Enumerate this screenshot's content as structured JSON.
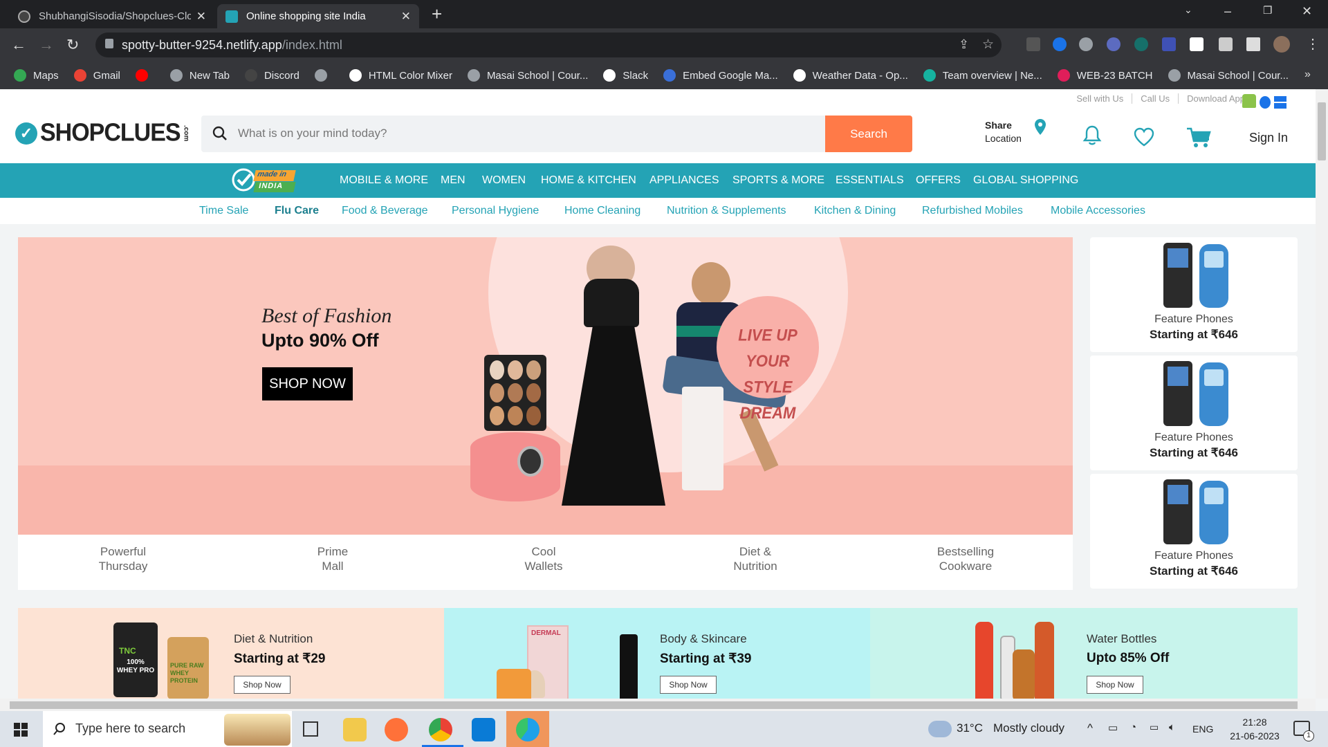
{
  "browser": {
    "tabs": [
      {
        "title": "ShubhangiSisodia/Shopclues-Clo"
      },
      {
        "title": "Online shopping site India"
      }
    ],
    "url_host": "spotty-butter-9254.netlify.app",
    "url_path": "/index.html",
    "bookmarks": [
      {
        "label": "Maps",
        "icon": "maps-icon",
        "color": "#34a853"
      },
      {
        "label": "Gmail",
        "icon": "gmail-icon",
        "color": "#ea4335"
      },
      {
        "label": "",
        "icon": "youtube-icon",
        "color": "#ff0000"
      },
      {
        "label": "New Tab",
        "icon": "globe-icon",
        "color": "#9aa0a6"
      },
      {
        "label": "Discord",
        "icon": "discord-icon",
        "color": "#444"
      },
      {
        "label": "",
        "icon": "globe-icon",
        "color": "#9aa0a6"
      },
      {
        "label": "HTML Color Mixer",
        "icon": "m-icon",
        "color": "#fff"
      },
      {
        "label": "Masai School | Cour...",
        "icon": "globe-icon",
        "color": "#9aa0a6"
      },
      {
        "label": "Slack",
        "icon": "slack-icon",
        "color": "#fff"
      },
      {
        "label": "Embed Google Ma...",
        "icon": "e-icon",
        "color": "#3a6fd8"
      },
      {
        "label": "Weather Data - Op...",
        "icon": "weather-icon",
        "color": "#fff"
      },
      {
        "label": "Team overview | Ne...",
        "icon": "diamond-icon",
        "color": "#16b3a0"
      },
      {
        "label": "WEB-23 BATCH",
        "icon": "slack-icon",
        "color": "#e01e5a"
      },
      {
        "label": "Masai School | Cour...",
        "icon": "globe-icon",
        "color": "#9aa0a6"
      }
    ]
  },
  "header": {
    "top_links": [
      "Sell with Us",
      "Call Us",
      "Download App"
    ],
    "logo": "SHOPCLUES",
    "logo_suffix": ".com",
    "search_placeholder": "What is on your mind today?",
    "search_button": "Search",
    "share_line1": "Share",
    "share_line2": "Location",
    "sign_in": "Sign In",
    "brand_color": "#24a3b5",
    "accent_color": "#ff7a48"
  },
  "made_in_india": {
    "line1": "made in",
    "line2": "INDIA"
  },
  "categories": [
    "MOBILE & MORE",
    "MEN",
    "WOMEN",
    "HOME & KITCHEN",
    "APPLIANCES",
    "SPORTS & MORE",
    "ESSENTIALS",
    "OFFERS",
    "GLOBAL SHOPPING"
  ],
  "subcategories": [
    "Time Sale",
    "Flu Care",
    "Food & Beverage",
    "Personal Hygiene",
    "Home Cleaning",
    "Nutrition & Supplements",
    "Kitchen & Dining",
    "Refurbished Mobiles",
    "Mobile Accessories"
  ],
  "hero": {
    "title": "Best of Fashion",
    "subtitle": "Upto 90% Off",
    "cta": "SHOP NOW",
    "bubble": [
      "LIVE UP",
      "YOUR STYLE",
      "DREAM"
    ],
    "strip": [
      {
        "l1": "Powerful",
        "l2": "Thursday"
      },
      {
        "l1": "Prime",
        "l2": "Mall"
      },
      {
        "l1": "Cool",
        "l2": "Wallets"
      },
      {
        "l1": "Diet &",
        "l2": "Nutrition"
      },
      {
        "l1": "Bestselling",
        "l2": "Cookware"
      }
    ]
  },
  "side_products": [
    {
      "name": "Feature Phones",
      "price": "Starting at ₹646"
    },
    {
      "name": "Feature Phones",
      "price": "Starting at ₹646"
    },
    {
      "name": "Feature Phones",
      "price": "Starting at ₹646"
    }
  ],
  "promos": [
    {
      "title": "Diet & Nutrition",
      "offer": "Starting at ₹29",
      "cta": "Shop Now",
      "bg": "#fde3d4"
    },
    {
      "title": "Body & Skincare",
      "offer": "Starting at ₹39",
      "cta": "Shop Now",
      "bg": "#b9f3f4"
    },
    {
      "title": "Water Bottles",
      "offer": "Upto 85% Off",
      "cta": "Shop Now",
      "bg": "#c8f4ec"
    }
  ],
  "promo_badges": [
    "TNC",
    "100% WHEY PRO",
    "PURE RAW WHEY PROTEIN",
    "DERMAL"
  ],
  "taskbar": {
    "search_placeholder": "Type here to search",
    "weather_temp": "31°C",
    "weather_desc": "Mostly cloudy",
    "lang": "ENG",
    "time": "21:28",
    "date": "21-06-2023",
    "notifications": "1"
  }
}
